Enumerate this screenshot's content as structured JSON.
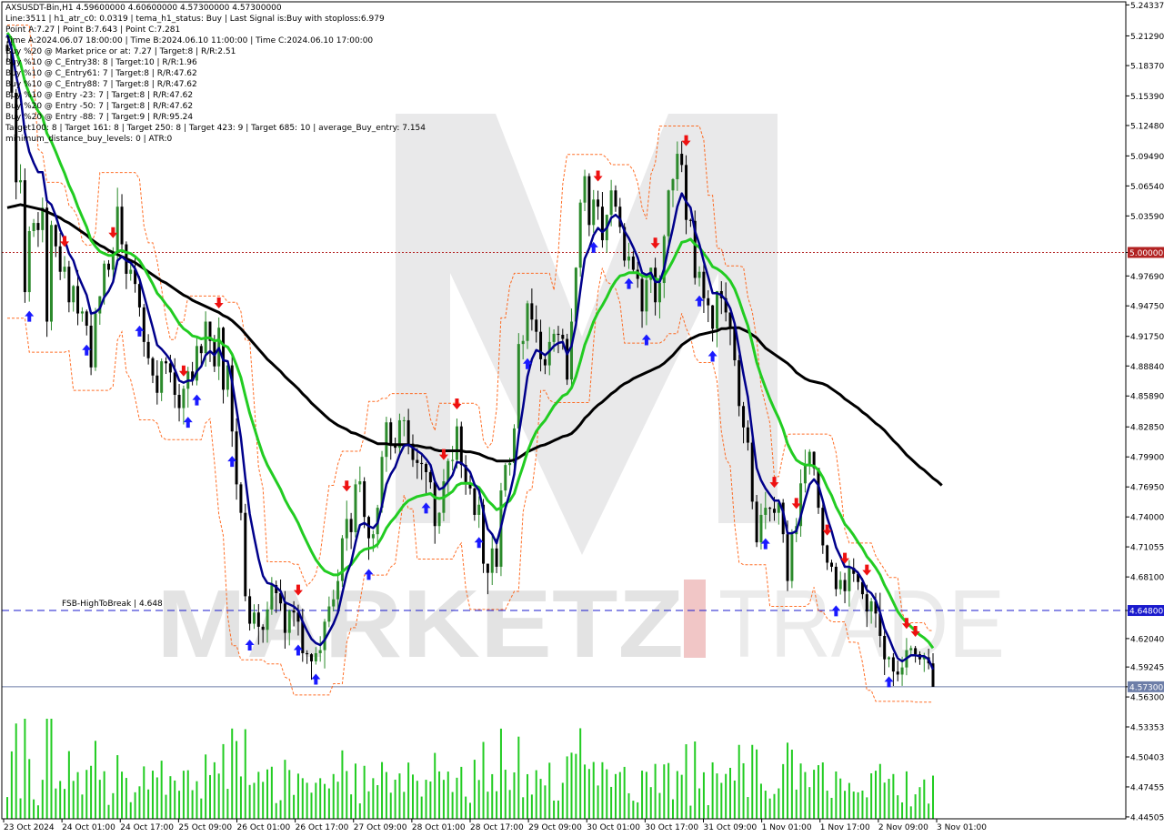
{
  "symbol_header": "AXSUSDT-Bin,H1  4.59600000 4.60600000 4.57300000 4.57300000",
  "info_lines": [
    "Line:3511  |  h1_atr_c0: 0.0319  |  tema_h1_status: Buy  |  Last Signal is:Buy with stoploss:6.979",
    "Point A:7.27  |  Point B:7.643  |  Point C:7.281",
    "Time A:2024.06.07 18:00:00  |  Time B:2024.06.10 11:00:00  |  Time C:2024.06.10 17:00:00",
    "Buy %20 @ Market price or at: 7.27  |  Target:8  |  R/R:2.51",
    "Buy %10 @ C_Entry38: 8  |  Target:10  |  R/R:1.96",
    "Buy %10 @ C_Entry61: 7  |  Target:8  |  R/R:47.62",
    "Buy %10 @ C_Entry88: 7  |  Target:8  |  R/R:47.62",
    "Buy %10 @ Entry -23: 7  |  Target:8  |  R/R:47.62",
    "Buy %20 @ Entry -50: 7  |  Target:8  |  R/R:47.62",
    "Buy %20 @ Entry -88: 7  |  Target:9  |  R/R:95.24",
    "Target100: 8  |  Target 161: 8  |  Target 250: 8  |  Target 423: 9  |  Target 685: 10  |  average_Buy_entry: 7.154",
    "minimum_distance_buy_levels: 0  |  ATR:0"
  ],
  "watermark": {
    "left": "MARKETZ",
    "right": "TRADE"
  },
  "fsb_label": "FSB-HighToBreak  |  4.648",
  "chart_data": {
    "type": "candlestick",
    "title": "AXSUSDT-Bin,H1",
    "ohlc_last": {
      "open": 4.596,
      "high": 4.606,
      "low": 4.573,
      "close": 4.573
    },
    "ylim": [
      4.4432,
      5.2464
    ],
    "y_ticks": [
      "5.24337",
      "5.21290",
      "5.18370",
      "5.15390",
      "5.12480",
      "5.09490",
      "5.06540",
      "5.03590",
      "5.00000",
      "4.97690",
      "4.94750",
      "4.91750",
      "4.88840",
      "4.85890",
      "4.82850",
      "4.79900",
      "4.76950",
      "4.74000",
      "4.71055",
      "4.68100",
      "4.64800",
      "4.62040",
      "4.59245",
      "4.57300",
      "4.56300",
      "4.53353",
      "4.50403",
      "4.47455",
      "4.44505"
    ],
    "x_ticks": [
      "23 Oct 2024",
      "24 Oct 01:00",
      "24 Oct 17:00",
      "25 Oct 09:00",
      "26 Oct 01:00",
      "26 Oct 17:00",
      "27 Oct 09:00",
      "28 Oct 01:00",
      "28 Oct 17:00",
      "29 Oct 09:00",
      "30 Oct 01:00",
      "30 Oct 17:00",
      "31 Oct 09:00",
      "1 Nov 01:00",
      "1 Nov 17:00",
      "2 Nov 09:00",
      "3 Nov 01:00"
    ],
    "horizontal_lines": [
      {
        "name": "round-level",
        "value": 5.0,
        "label": "5.00000",
        "style": "dotted",
        "color": "#b22222"
      },
      {
        "name": "fsb-high-to-break",
        "value": 4.648,
        "label": "4.64800",
        "style": "dashed",
        "color": "#1a1acd"
      },
      {
        "name": "current-price",
        "value": 4.573,
        "label": "4.57300",
        "style": "solid",
        "color": "#6d7ea8"
      }
    ],
    "closes": [
      5.198,
      5.157,
      5.069,
      5.071,
      4.961,
      5.021,
      5.029,
      5.022,
      5.044,
      4.932,
      5.027,
      5.006,
      4.981,
      4.986,
      4.951,
      4.967,
      4.94,
      4.942,
      4.928,
      4.887,
      4.94,
      4.957,
      4.989,
      4.983,
      5.0,
      5.045,
      5.008,
      4.979,
      4.983,
      4.969,
      4.946,
      4.912,
      4.896,
      4.879,
      4.862,
      4.893,
      4.891,
      4.882,
      4.86,
      4.847,
      4.866,
      4.883,
      4.874,
      4.908,
      4.901,
      4.932,
      4.913,
      4.888,
      4.926,
      4.865,
      4.889,
      4.824,
      4.772,
      4.744,
      4.662,
      4.635,
      4.646,
      4.632,
      4.629,
      4.649,
      4.673,
      4.665,
      4.655,
      4.626,
      4.648,
      4.646,
      4.637,
      4.606,
      4.605,
      4.598,
      4.606,
      4.609,
      4.637,
      4.652,
      4.659,
      4.677,
      4.719,
      4.738,
      4.725,
      4.772,
      4.775,
      4.74,
      4.719,
      4.723,
      4.749,
      4.799,
      4.833,
      4.811,
      4.808,
      4.835,
      4.835,
      4.812,
      4.796,
      4.793,
      4.792,
      4.784,
      4.774,
      4.731,
      4.744,
      4.775,
      4.795,
      4.796,
      4.829,
      4.791,
      4.773,
      4.768,
      4.742,
      4.752,
      4.694,
      4.685,
      4.709,
      4.691,
      4.766,
      4.791,
      4.793,
      4.827,
      4.91,
      4.913,
      4.95,
      4.934,
      4.922,
      4.895,
      4.889,
      4.912,
      4.92,
      4.919,
      4.915,
      4.875,
      4.932,
      4.985,
      5.049,
      5.075,
      5.027,
      5.052,
      5.045,
      5.012,
      5.037,
      5.061,
      5.045,
      5.025,
      4.992,
      4.996,
      4.983,
      4.974,
      4.942,
      4.973,
      4.985,
      4.951,
      4.97,
      5.016,
      5.061,
      5.072,
      5.097,
      5.086,
      5.032,
      5.031,
      4.975,
      4.981,
      4.955,
      4.948,
      4.925,
      4.962,
      4.955,
      4.941,
      4.926,
      4.894,
      4.849,
      4.828,
      4.813,
      4.755,
      4.715,
      4.742,
      4.749,
      4.748,
      4.744,
      4.754,
      4.723,
      4.677,
      4.723,
      4.731,
      4.773,
      4.792,
      4.804,
      4.788,
      4.749,
      4.712,
      4.695,
      4.691,
      4.669,
      4.678,
      4.667,
      4.69,
      4.684,
      4.676,
      4.664,
      4.647,
      4.657,
      4.645,
      4.623,
      4.6,
      4.602,
      4.588,
      4.585,
      4.592,
      4.609,
      4.611,
      4.605,
      4.6,
      4.602,
      4.596,
      4.573
    ],
    "tema_fast": [
      5.214,
      5.2,
      5.174,
      5.154,
      5.118,
      5.099,
      5.088,
      5.079,
      5.079,
      5.051,
      5.047,
      5.036,
      5.022,
      5.013,
      4.999,
      4.992,
      4.978,
      4.968,
      4.958,
      4.94,
      4.941,
      4.945,
      4.956,
      4.962,
      4.971,
      4.992,
      4.996,
      4.992,
      4.99,
      4.984,
      4.974,
      4.958,
      4.942,
      4.926,
      4.909,
      4.905,
      4.9,
      4.894,
      4.885,
      4.874,
      4.872,
      4.874,
      4.874,
      4.883,
      4.888,
      4.899,
      4.903,
      4.899,
      4.906,
      4.894,
      4.893,
      4.873,
      4.846,
      4.818,
      4.778,
      4.743,
      4.72,
      4.699,
      4.682,
      4.675,
      4.674,
      4.671,
      4.667,
      4.656,
      4.654,
      4.652,
      4.648,
      4.637,
      4.628,
      4.62,
      4.616,
      4.614,
      4.619,
      4.627,
      4.635,
      4.646,
      4.665,
      4.684,
      4.695,
      4.715,
      4.732,
      4.734,
      4.731,
      4.729,
      4.734,
      4.751,
      4.772,
      4.782,
      4.789,
      4.801,
      4.81,
      4.811,
      4.808,
      4.805,
      4.802,
      4.797,
      4.791,
      4.775,
      4.767,
      4.769,
      4.775,
      4.781,
      4.794,
      4.793,
      4.789,
      4.784,
      4.772,
      4.766,
      4.746,
      4.728,
      4.723,
      4.714,
      4.73,
      4.749,
      4.763,
      4.782,
      4.82,
      4.848,
      4.878,
      4.895,
      4.904,
      4.902,
      4.899,
      4.903,
      4.908,
      4.911,
      4.912,
      4.9,
      4.908,
      4.929,
      4.963,
      4.994,
      5.004,
      5.017,
      5.024,
      5.02,
      5.024,
      5.034,
      5.037,
      5.033,
      5.021,
      5.014,
      5.005,
      4.995,
      4.98,
      4.978,
      4.98,
      4.971,
      4.971,
      4.984,
      5.005,
      5.024,
      5.045,
      5.058,
      5.05,
      5.044,
      5.021,
      5.008,
      4.991,
      4.976,
      4.96,
      4.96,
      4.958,
      4.953,
      4.945,
      4.93,
      4.905,
      4.88,
      4.858,
      4.823,
      4.788,
      4.776,
      4.768,
      4.762,
      4.756,
      4.756,
      4.745,
      4.724,
      4.724,
      4.726,
      4.741,
      4.757,
      4.772,
      4.777,
      4.771,
      4.756,
      4.739,
      4.726,
      4.71,
      4.701,
      4.691,
      4.691,
      4.689,
      4.685,
      4.678,
      4.668,
      4.665,
      4.658,
      4.646,
      4.63,
      4.621,
      4.61,
      4.601,
      4.598,
      4.601,
      4.604,
      4.604,
      4.603,
      4.603,
      4.6,
      4.59
    ],
    "ma_mid": [
      5.216,
      5.21,
      5.197,
      5.186,
      5.168,
      5.156,
      5.147,
      5.139,
      5.133,
      5.117,
      5.109,
      5.099,
      5.088,
      5.078,
      5.066,
      5.057,
      5.045,
      5.035,
      5.025,
      5.012,
      5.006,
      5.001,
      4.999,
      4.997,
      4.997,
      5.001,
      5.002,
      5.0,
      4.999,
      4.996,
      4.992,
      4.985,
      4.977,
      4.969,
      4.96,
      4.955,
      4.949,
      4.944,
      4.937,
      4.93,
      4.925,
      4.922,
      4.918,
      4.917,
      4.915,
      4.916,
      4.916,
      4.913,
      4.914,
      4.909,
      4.907,
      4.9,
      4.889,
      4.877,
      4.859,
      4.842,
      4.828,
      4.814,
      4.801,
      4.791,
      4.783,
      4.775,
      4.767,
      4.757,
      4.749,
      4.742,
      4.734,
      4.724,
      4.715,
      4.706,
      4.698,
      4.692,
      4.687,
      4.685,
      4.683,
      4.683,
      4.686,
      4.69,
      4.693,
      4.699,
      4.705,
      4.708,
      4.709,
      4.71,
      4.713,
      4.72,
      4.729,
      4.735,
      4.74,
      4.746,
      4.752,
      4.756,
      4.758,
      4.76,
      4.761,
      4.762,
      4.763,
      4.759,
      4.758,
      4.759,
      4.762,
      4.765,
      4.771,
      4.773,
      4.773,
      4.773,
      4.771,
      4.769,
      4.763,
      4.756,
      4.752,
      4.747,
      4.749,
      4.753,
      4.756,
      4.763,
      4.777,
      4.79,
      4.804,
      4.815,
      4.824,
      4.83,
      4.835,
      4.842,
      4.849,
      4.854,
      4.859,
      4.861,
      4.867,
      4.878,
      4.893,
      4.909,
      4.92,
      4.932,
      4.941,
      4.948,
      4.956,
      4.965,
      4.972,
      4.977,
      4.978,
      4.98,
      4.98,
      4.98,
      4.977,
      4.976,
      4.977,
      4.974,
      4.973,
      4.977,
      4.984,
      4.992,
      5.001,
      5.01,
      5.011,
      5.013,
      5.008,
      5.005,
      4.999,
      4.993,
      4.986,
      4.984,
      4.981,
      4.977,
      4.972,
      4.964,
      4.953,
      4.94,
      4.928,
      4.911,
      4.892,
      4.879,
      4.867,
      4.856,
      4.846,
      4.837,
      4.826,
      4.812,
      4.803,
      4.796,
      4.793,
      4.791,
      4.791,
      4.79,
      4.786,
      4.779,
      4.769,
      4.761,
      4.75,
      4.742,
      4.733,
      4.728,
      4.722,
      4.715,
      4.709,
      4.701,
      4.696,
      4.69,
      4.683,
      4.673,
      4.665,
      4.656,
      4.647,
      4.641,
      4.636,
      4.632,
      4.628,
      4.624,
      4.621,
      4.617,
      4.611
    ],
    "ma_slow": [
      5.044,
      5.045,
      5.046,
      5.047,
      5.046,
      5.045,
      5.044,
      5.043,
      5.042,
      5.04,
      5.038,
      5.036,
      5.034,
      5.031,
      5.029,
      5.026,
      5.023,
      5.02,
      5.017,
      5.013,
      5.01,
      5.007,
      5.005,
      5.002,
      5.0,
      4.998,
      4.996,
      4.994,
      4.992,
      4.99,
      4.987,
      4.984,
      4.981,
      4.978,
      4.975,
      4.972,
      4.97,
      4.967,
      4.964,
      4.961,
      4.958,
      4.956,
      4.953,
      4.951,
      4.949,
      4.947,
      4.945,
      4.943,
      4.941,
      4.938,
      4.936,
      4.933,
      4.929,
      4.925,
      4.92,
      4.915,
      4.91,
      4.905,
      4.9,
      4.895,
      4.891,
      4.887,
      4.883,
      4.878,
      4.874,
      4.87,
      4.866,
      4.861,
      4.857,
      4.852,
      4.848,
      4.844,
      4.84,
      4.836,
      4.833,
      4.83,
      4.828,
      4.826,
      4.823,
      4.822,
      4.82,
      4.818,
      4.816,
      4.814,
      4.812,
      4.812,
      4.812,
      4.811,
      4.811,
      4.811,
      4.811,
      4.811,
      4.81,
      4.81,
      4.809,
      4.808,
      4.808,
      4.806,
      4.805,
      4.805,
      4.805,
      4.805,
      4.805,
      4.805,
      4.804,
      4.804,
      4.803,
      4.802,
      4.8,
      4.798,
      4.797,
      4.795,
      4.795,
      4.795,
      4.795,
      4.796,
      4.798,
      4.801,
      4.804,
      4.806,
      4.808,
      4.81,
      4.811,
      4.813,
      4.815,
      4.817,
      4.819,
      4.82,
      4.822,
      4.826,
      4.831,
      4.837,
      4.841,
      4.846,
      4.85,
      4.853,
      4.857,
      4.861,
      4.864,
      4.868,
      4.871,
      4.873,
      4.876,
      4.878,
      4.88,
      4.882,
      4.884,
      4.886,
      4.888,
      4.891,
      4.895,
      4.899,
      4.904,
      4.909,
      4.912,
      4.915,
      4.917,
      4.919,
      4.92,
      4.921,
      4.922,
      4.923,
      4.925,
      4.925,
      4.926,
      4.926,
      4.926,
      4.924,
      4.922,
      4.919,
      4.916,
      4.911,
      4.906,
      4.903,
      4.9,
      4.897,
      4.894,
      4.891,
      4.887,
      4.882,
      4.879,
      4.876,
      4.874,
      4.873,
      4.872,
      4.871,
      4.869,
      4.866,
      4.863,
      4.86,
      4.856,
      4.853,
      4.85,
      4.847,
      4.843,
      4.84,
      4.836,
      4.832,
      4.829,
      4.825,
      4.82,
      4.815,
      4.811,
      4.806,
      4.801,
      4.797,
      4.793,
      4.789,
      4.786,
      4.782,
      4.778,
      4.775,
      4.771
    ],
    "volume_max_label": "relative",
    "signals": {
      "buy_arrows": [
        5,
        18,
        30,
        41,
        43,
        51,
        55,
        66,
        70,
        82,
        95,
        107,
        118,
        133,
        141,
        145,
        157,
        160,
        172,
        188,
        200
      ],
      "sell_arrows": [
        13,
        24,
        40,
        48,
        66,
        77,
        99,
        102,
        134,
        147,
        154,
        174,
        179,
        186,
        190,
        195,
        204,
        206
      ]
    },
    "marker_color_buy": "#1a1aff",
    "marker_color_sell": "#ee1111",
    "colors": {
      "bull_candle": "#2b8a2b",
      "bear_candle": "#000000",
      "tema_fast": "#00008b",
      "ma_mid": "#22cc22",
      "ma_slow": "#000000",
      "channel": "#ff5500",
      "volume": "#22cc22"
    }
  }
}
